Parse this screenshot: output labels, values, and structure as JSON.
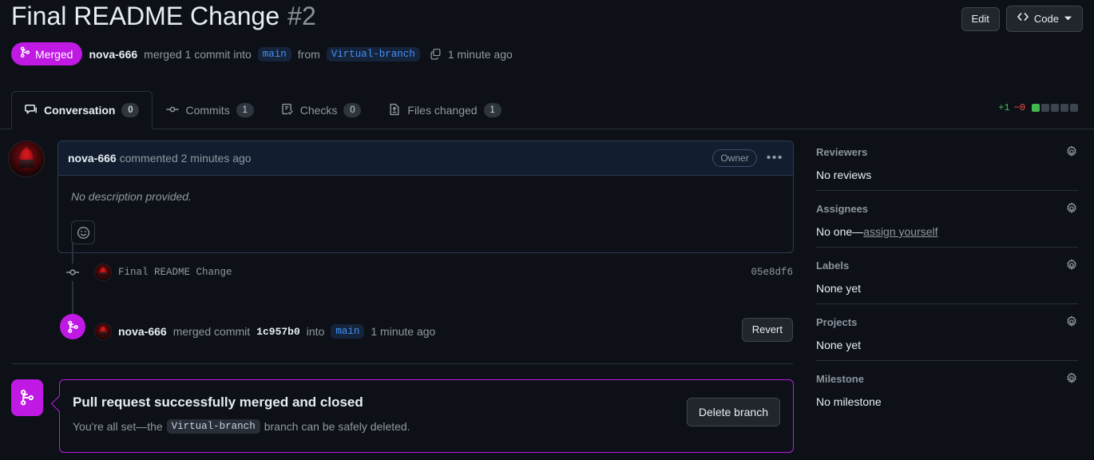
{
  "header": {
    "title": "Final README Change",
    "number": "#2",
    "edit_label": "Edit",
    "code_label": "Code",
    "status_badge": "Merged",
    "author": "nova-666",
    "merged_text": "merged 1 commit into",
    "base_branch": "main",
    "from_text": "from",
    "head_branch": "Virtual-branch",
    "time": "1 minute ago"
  },
  "tabs": [
    {
      "label": "Conversation",
      "count": "0",
      "icon": "comment-icon",
      "active": true
    },
    {
      "label": "Commits",
      "count": "1",
      "icon": "commit-icon",
      "active": false
    },
    {
      "label": "Checks",
      "count": "0",
      "icon": "checklist-icon",
      "active": false
    },
    {
      "label": "Files changed",
      "count": "1",
      "icon": "file-diff-icon",
      "active": false
    }
  ],
  "diffstat": {
    "additions": "+1",
    "deletions": "−0",
    "blocks_total": 5,
    "blocks_filled": 1,
    "add_color": "#3fb950",
    "del_color": "#f85149"
  },
  "comment": {
    "author": "nova-666",
    "action": "commented 2 minutes ago",
    "role_badge": "Owner",
    "body": "No description provided.",
    "reaction_icon": "smiley-icon",
    "menu_icon": "kebab-menu-icon"
  },
  "timeline": {
    "commit": {
      "message": "Final README Change",
      "sha": "05e8df6",
      "icon": "commit-dot-icon"
    },
    "merge_event": {
      "author": "nova-666",
      "text_before": "merged commit",
      "sha": "1c957b0",
      "text_into": "into",
      "branch": "main",
      "time": "1 minute ago",
      "revert_label": "Revert",
      "icon": "git-merge-icon"
    }
  },
  "merged_panel": {
    "icon": "git-merge-icon",
    "title": "Pull request successfully merged and closed",
    "desc_before": "You're all set—the",
    "branch": "Virtual-branch",
    "desc_after": "branch can be safely deleted.",
    "delete_label": "Delete branch",
    "accent_color": "#bf19e3"
  },
  "sidebar": [
    {
      "title": "Reviewers",
      "value": "No reviews",
      "link": null,
      "gear": "gear-icon"
    },
    {
      "title": "Assignees",
      "value": "No one—",
      "link": "assign yourself",
      "gear": "gear-icon"
    },
    {
      "title": "Labels",
      "value": "None yet",
      "link": null,
      "gear": "gear-icon"
    },
    {
      "title": "Projects",
      "value": "None yet",
      "link": null,
      "gear": "gear-icon"
    },
    {
      "title": "Milestone",
      "value": "No milestone",
      "link": null,
      "gear": "gear-icon"
    }
  ]
}
